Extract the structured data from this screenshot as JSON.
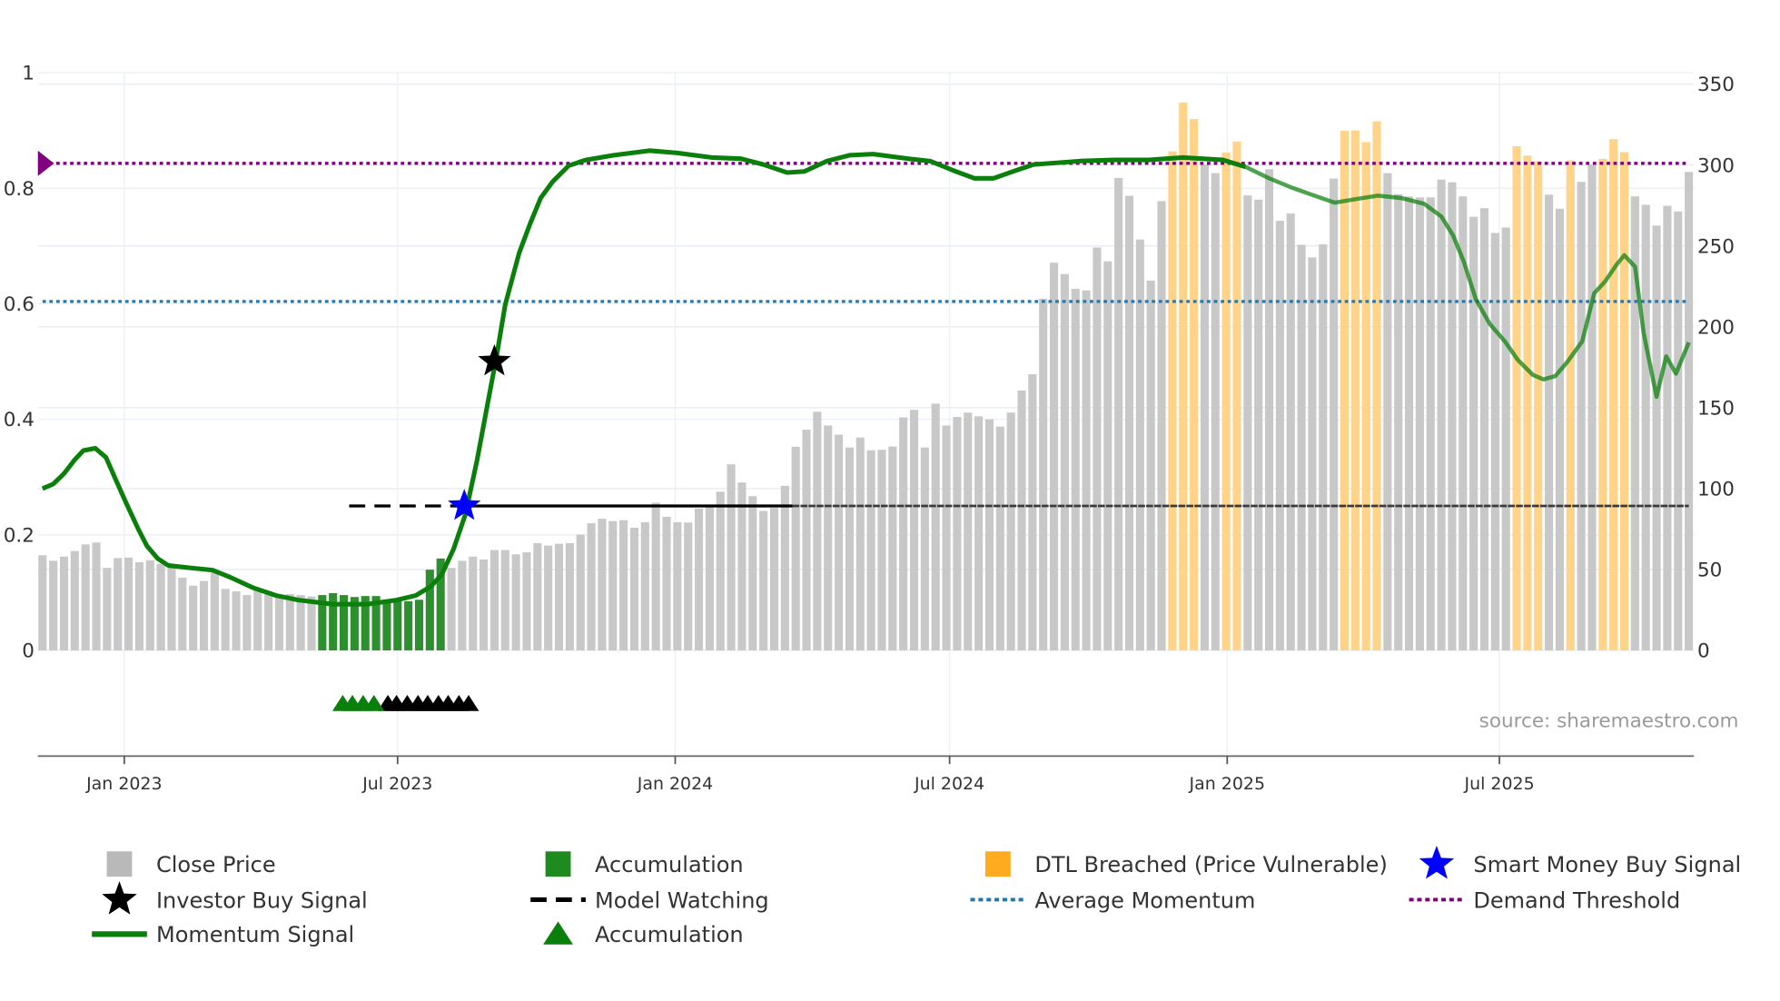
{
  "chart_data": {
    "type": "bar+line",
    "title": "",
    "source_label": "source: sharemaestro.com",
    "x_unit": "weekly bar index",
    "x_ticks": [
      {
        "label": "Jan 2023",
        "at": 7.6
      },
      {
        "label": "Jul 2023",
        "at": 33.0
      },
      {
        "label": "Jan 2024",
        "at": 58.8
      },
      {
        "label": "Jul 2024",
        "at": 84.3
      },
      {
        "label": "Jan 2025",
        "at": 110.1
      },
      {
        "label": "Jul 2025",
        "at": 135.4
      }
    ],
    "left_axis": {
      "range": [
        -0.183,
        1
      ],
      "ticks": [
        {
          "v": 0,
          "label": "0"
        },
        {
          "v": 0.2,
          "label": "0.2"
        },
        {
          "v": 0.4,
          "label": "0.4"
        },
        {
          "v": 0.6,
          "label": "0.6"
        },
        {
          "v": 0.8,
          "label": "0.8"
        },
        {
          "v": 1,
          "label": "1"
        }
      ]
    },
    "right_axis": {
      "range": [
        0,
        350
      ],
      "ticks": [
        {
          "v": 0,
          "label": "0"
        },
        {
          "v": 50,
          "label": "50"
        },
        {
          "v": 100,
          "label": "100"
        },
        {
          "v": 150,
          "label": "150"
        },
        {
          "v": 200,
          "label": "200"
        },
        {
          "v": 250,
          "label": "250"
        },
        {
          "v": 300,
          "label": "300"
        },
        {
          "v": 350,
          "label": "350"
        }
      ]
    },
    "close_price": [
      58.8,
      55.4,
      58,
      61.4,
      65.5,
      66.7,
      51,
      57.1,
      57.4,
      54.5,
      55.7,
      53.6,
      51.6,
      44.9,
      40,
      42.9,
      48.1,
      38,
      36.5,
      34.2,
      37.7,
      36.5,
      33.6,
      34.8,
      34.2,
      33.3,
      34.2,
      35.4,
      34.2,
      33,
      33.6,
      33.6,
      30.4,
      30.4,
      30.4,
      31.3,
      49.9,
      56.8,
      51,
      55.4,
      58,
      56.2,
      62,
      62,
      59.4,
      60.6,
      66.3,
      64.8,
      65.9,
      66.3,
      71.6,
      78.6,
      81.4,
      79.9,
      80.5,
      75.8,
      79.2,
      91.3,
      82.6,
      79.2,
      79,
      87.7,
      89,
      98.1,
      115,
      103.8,
      95.3,
      86.2,
      88.1,
      101.7,
      125.9,
      136.4,
      147.5,
      139,
      133.3,
      125.4,
      131.6,
      123.7,
      124,
      126,
      144,
      148.7,
      125.4,
      152.5,
      139,
      144.3,
      147,
      144.7,
      142.8,
      138.3,
      147,
      160.6,
      170.7,
      217.4,
      239.6,
      232.6,
      223.5,
      222.5,
      249,
      240.5,
      292,
      281,
      254,
      228.6,
      277.7,
      308.4,
      338.6,
      328.4,
      300.3,
      295,
      307.8,
      314.5,
      281.2,
      278.6,
      297.4,
      265.5,
      270.1,
      250.7,
      242.9,
      251,
      291.6,
      321.2,
      321.4,
      314.2,
      327,
      295,
      282,
      280.6,
      280,
      280,
      291,
      289.3,
      280.6,
      268,
      273.3,
      258,
      261.4,
      311.6,
      305.8,
      302.3,
      281.7,
      273,
      302.9,
      289.6,
      300.3,
      303.8,
      316,
      308,
      280.6,
      275.4,
      262.6,
      274.8,
      271.3,
      295.7
    ],
    "accumulation_bars": [
      26,
      27,
      28,
      29,
      30,
      31,
      32,
      33,
      34,
      35,
      36,
      37
    ],
    "dtl_breached_bars": [
      105,
      106,
      107,
      110,
      111,
      121,
      122,
      123,
      124,
      137,
      138,
      139,
      142,
      145,
      146,
      147
    ],
    "momentum_signal": [
      [
        0,
        0.28
      ],
      [
        1,
        0.288
      ],
      [
        2,
        0.306
      ],
      [
        3,
        0.33
      ],
      [
        3.8,
        0.346
      ],
      [
        4.9,
        0.35
      ],
      [
        5.9,
        0.334
      ],
      [
        6.7,
        0.3
      ],
      [
        7.8,
        0.254
      ],
      [
        8.9,
        0.21
      ],
      [
        9.7,
        0.181
      ],
      [
        10.7,
        0.159
      ],
      [
        11.7,
        0.147
      ],
      [
        13.7,
        0.143
      ],
      [
        15.8,
        0.139
      ],
      [
        17.4,
        0.127
      ],
      [
        19.5,
        0.109
      ],
      [
        21.7,
        0.095
      ],
      [
        23.8,
        0.087
      ],
      [
        27,
        0.08
      ],
      [
        30.2,
        0.08
      ],
      [
        32.9,
        0.087
      ],
      [
        34.7,
        0.095
      ],
      [
        36.1,
        0.111
      ],
      [
        37.1,
        0.131
      ],
      [
        38.2,
        0.175
      ],
      [
        39.3,
        0.235
      ],
      [
        40.4,
        0.33
      ],
      [
        41.4,
        0.43
      ],
      [
        42.2,
        0.509
      ],
      [
        43,
        0.598
      ],
      [
        44.3,
        0.688
      ],
      [
        45.3,
        0.738
      ],
      [
        46.3,
        0.783
      ],
      [
        47.4,
        0.811
      ],
      [
        48.9,
        0.839
      ],
      [
        50.5,
        0.849
      ],
      [
        53.1,
        0.857
      ],
      [
        56.4,
        0.865
      ],
      [
        59,
        0.861
      ],
      [
        62.2,
        0.853
      ],
      [
        64.9,
        0.851
      ],
      [
        67,
        0.841
      ],
      [
        69.2,
        0.827
      ],
      [
        70.8,
        0.829
      ],
      [
        72.9,
        0.847
      ],
      [
        75,
        0.857
      ],
      [
        77.2,
        0.859
      ],
      [
        80.4,
        0.851
      ],
      [
        82.5,
        0.847
      ],
      [
        84.6,
        0.831
      ],
      [
        86.6,
        0.817
      ],
      [
        88.4,
        0.817
      ],
      [
        90.5,
        0.831
      ],
      [
        92.1,
        0.841
      ],
      [
        96.4,
        0.847
      ],
      [
        99.6,
        0.849
      ],
      [
        102.8,
        0.849
      ],
      [
        106,
        0.853
      ],
      [
        109.7,
        0.849
      ],
      [
        111.8,
        0.837
      ],
      [
        114,
        0.817
      ],
      [
        116.1,
        0.801
      ],
      [
        118.2,
        0.787
      ],
      [
        120.1,
        0.775
      ],
      [
        122,
        0.781
      ],
      [
        124.1,
        0.787
      ],
      [
        126.3,
        0.783
      ],
      [
        128.4,
        0.773
      ],
      [
        130,
        0.751
      ],
      [
        131.1,
        0.718
      ],
      [
        132.1,
        0.672
      ],
      [
        133.2,
        0.608
      ],
      [
        134.5,
        0.565
      ],
      [
        135.9,
        0.535
      ],
      [
        137.1,
        0.503
      ],
      [
        138.5,
        0.477
      ],
      [
        139.5,
        0.469
      ],
      [
        140.6,
        0.475
      ],
      [
        141.7,
        0.499
      ],
      [
        143.1,
        0.535
      ],
      [
        144.2,
        0.618
      ],
      [
        145.2,
        0.638
      ],
      [
        146.3,
        0.668
      ],
      [
        147,
        0.684
      ],
      [
        148,
        0.664
      ],
      [
        148.8,
        0.549
      ],
      [
        150,
        0.439
      ],
      [
        150.9,
        0.509
      ],
      [
        151.8,
        0.479
      ],
      [
        153,
        0.533
      ]
    ],
    "demand_threshold": 0.843,
    "average_momentum": 0.604,
    "model_watching": {
      "value": 0.25,
      "start": 28.5,
      "dashed_until": 39.2,
      "solid_until": 69.7,
      "end": 153
    },
    "smart_money_buy_signal": {
      "x": 39.2,
      "y": 0.25
    },
    "investor_buy_signal": {
      "x": 42.0,
      "y": 0.5
    },
    "accumulation_triangles": {
      "y": -0.091,
      "green": [
        27.9,
        28.8,
        29.8,
        30.8
      ],
      "black": [
        32.1,
        32.9,
        33.9,
        34.9,
        35.8,
        36.8,
        37.7,
        38.7,
        39.6
      ]
    },
    "legend_placement": "bottom",
    "legend": [
      {
        "label": "Close Price",
        "icon": "square",
        "color": "#b9b9b9"
      },
      {
        "label": "Accumulation",
        "icon": "square",
        "color": "#1f8a1f"
      },
      {
        "label": "DTL Breached (Price Vulnerable)",
        "icon": "square",
        "color": "#ffab1f"
      },
      {
        "label": "Smart Money Buy Signal",
        "icon": "star",
        "color": "#0000ff"
      },
      {
        "label": "Investor Buy Signal",
        "icon": "star",
        "color": "#000000"
      },
      {
        "label": "Model Watching",
        "icon": "dash",
        "color": "#000000"
      },
      {
        "label": "Average Momentum",
        "icon": "dot",
        "color": "#1f77b4"
      },
      {
        "label": "Demand Threshold",
        "icon": "dot",
        "color": "#800080"
      },
      {
        "label": "Momentum Signal",
        "icon": "line",
        "color": "#0b7f0b"
      },
      {
        "label": "Accumulation",
        "icon": "triangle",
        "color": "#0b7f0b"
      }
    ],
    "colors": {
      "bar": "#c8c8c8",
      "accumulation_bar": "#2e8f2e",
      "dtl_bar": "#ffd38a",
      "momentum": "#0b7f0b",
      "avg": "#2a77a8",
      "demand": "#800080"
    }
  }
}
